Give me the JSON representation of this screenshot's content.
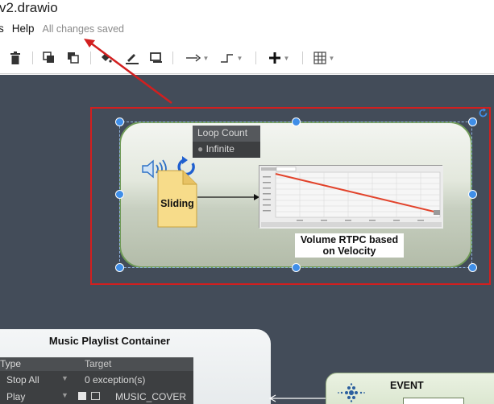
{
  "header": {
    "doc_title": "v2.drawio",
    "menu_partial": "s",
    "menu_help": "Help",
    "save_status": "All changes saved"
  },
  "toolbar": {
    "items": [
      {
        "name": "delete",
        "icon": "trash-icon"
      },
      {
        "name": "to-front",
        "icon": "to-front-icon"
      },
      {
        "name": "to-back",
        "icon": "to-back-icon"
      },
      {
        "name": "fill-color",
        "icon": "fill-color-icon"
      },
      {
        "name": "line-color",
        "icon": "line-color-icon"
      },
      {
        "name": "shadow",
        "icon": "shadow-icon"
      },
      {
        "name": "connection",
        "icon": "arrow-right-icon"
      },
      {
        "name": "waypoints",
        "icon": "waypoint-icon"
      },
      {
        "name": "insert",
        "icon": "plus-icon"
      },
      {
        "name": "table",
        "icon": "table-icon"
      }
    ]
  },
  "canvas": {
    "background": "#434c59",
    "selected_shape": {
      "note_label": "Sliding",
      "graph_caption": "Volume RTPC based on Velocity",
      "selection_color": "#d21f1f",
      "handle_color": "#3f8ee8"
    },
    "playlist": {
      "title": "Music Playlist Container",
      "columns": [
        "Type",
        "Target"
      ],
      "rows": [
        {
          "type": "Stop All",
          "target": "0 exception(s)"
        },
        {
          "type": "Play",
          "target": "MUSIC_COVER"
        }
      ],
      "loop_count_header": "Loop Count",
      "loop_count_value": "Infinite"
    },
    "event": {
      "label": "EVENT"
    }
  }
}
